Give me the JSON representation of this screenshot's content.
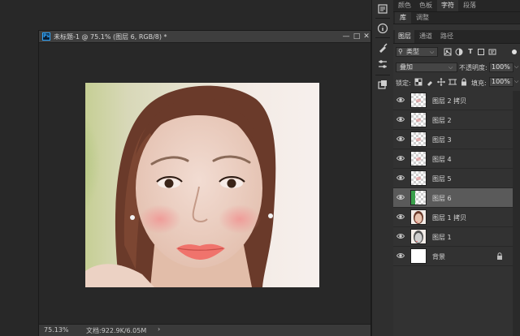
{
  "document": {
    "title": "未标题-1 @ 75.1% (图层 6, RGB/8) *",
    "ps_badge": "Ps",
    "zoom": "75.13%",
    "doc_size": "文档:922.9K/6.05M",
    "status_arrow": "›",
    "buttons": {
      "minimize": "—",
      "maximize": "□",
      "close": "✕"
    }
  },
  "toolbar_strip": {
    "icons": [
      "history-icon",
      "info-icon",
      "brush-icon",
      "adjust-icon",
      "styles-icon"
    ]
  },
  "top_tabs": {
    "tab1": "颜色",
    "tab2": "色板",
    "tab3": "字符",
    "tab4": "段落",
    "active": "tab3"
  },
  "library_tabs": {
    "tab1": "库",
    "tab2": "调整"
  },
  "layer_tabs": {
    "tab1": "图层",
    "tab2": "通道",
    "tab3": "路径"
  },
  "filter": {
    "kind_label": "类型",
    "caret": "⌵"
  },
  "blend": {
    "mode": "叠加",
    "opacity_label": "不透明度:",
    "opacity_value": "100%",
    "lock_label": "锁定:",
    "fill_label": "填充:",
    "fill_value": "100%"
  },
  "layers": [
    {
      "name": "图层 2 拷贝",
      "thumb": "transparent",
      "selected": false,
      "locked": false
    },
    {
      "name": "图层 2",
      "thumb": "transparent",
      "selected": false,
      "locked": false
    },
    {
      "name": "图层 3",
      "thumb": "transparent",
      "selected": false,
      "locked": false
    },
    {
      "name": "图层 4",
      "thumb": "transparent",
      "selected": false,
      "locked": false
    },
    {
      "name": "图层 5",
      "thumb": "transparent",
      "selected": false,
      "locked": false
    },
    {
      "name": "图层 6",
      "thumb": "transparent-green",
      "selected": true,
      "locked": false
    },
    {
      "name": "图层 1 拷贝",
      "thumb": "photo",
      "selected": false,
      "locked": false
    },
    {
      "name": "图层 1",
      "thumb": "photo-gray",
      "selected": false,
      "locked": false
    },
    {
      "name": "背景",
      "thumb": "white",
      "selected": false,
      "locked": true
    }
  ],
  "colors": {
    "selected_row": "#5a5a5a",
    "panel_bg": "#323232",
    "workspace_bg": "#282828"
  }
}
